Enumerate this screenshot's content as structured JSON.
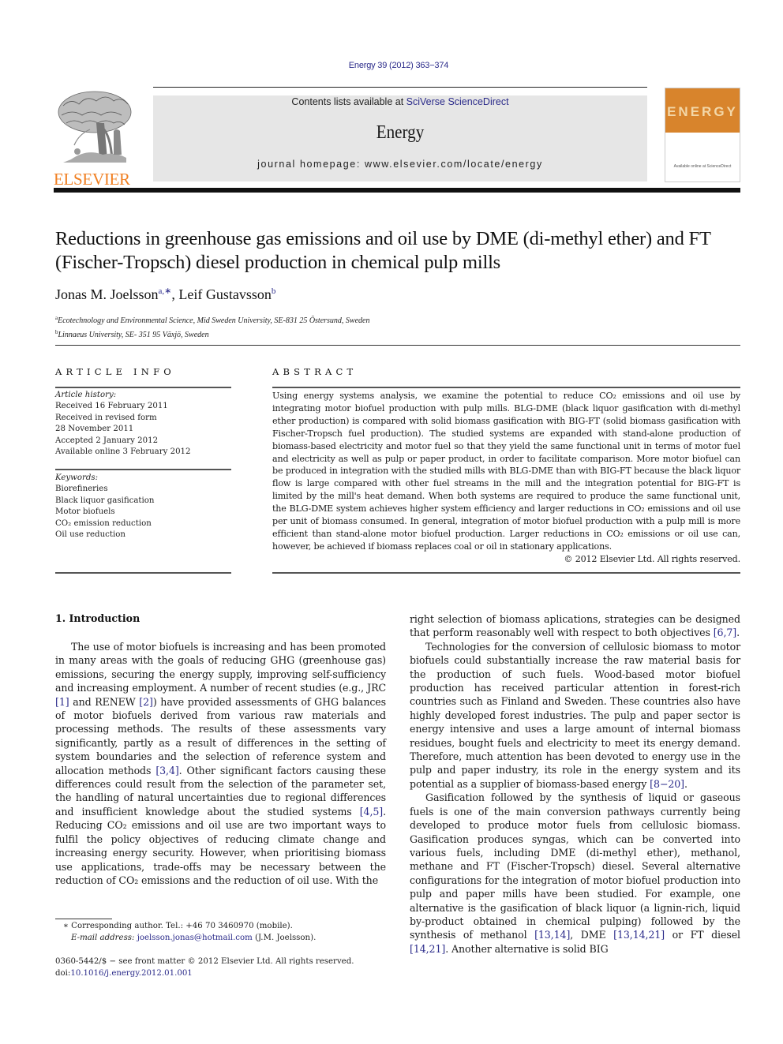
{
  "header": {
    "citation": "Energy 39 (2012) 363−374",
    "contents_prefix": "Contents lists available at ",
    "contents_link": "SciVerse ScienceDirect",
    "journal_name": "Energy",
    "homepage": "journal homepage: www.elsevier.com/locate/energy",
    "publisher_logo_text": "ELSEVIER",
    "cover_title": "ENERGY",
    "cover_footer": "Available online at ScienceDirect",
    "colors": {
      "publisher_orange": "#f07f21",
      "cover_orange": "#d8842c",
      "link_blue": "#2b2b8a",
      "banner_gray": "#e6e6e6"
    }
  },
  "article": {
    "title": "Reductions in greenhouse gas emissions and oil use by DME (di-methyl ether) and FT (Fischer-Tropsch) diesel production in chemical pulp mills",
    "authors": [
      {
        "name": "Jonas M. Joelsson",
        "marks": "a,∗"
      },
      {
        "name": "Leif Gustavsson",
        "marks": "b"
      }
    ],
    "author_separator": ", ",
    "affiliations": [
      {
        "mark": "a",
        "text": "Ecotechnology and Environmental Science, Mid Sweden University, SE-831 25 Östersund, Sweden"
      },
      {
        "mark": "b",
        "text": "Linnaeus University, SE- 351 95 Växjö, Sweden"
      }
    ]
  },
  "article_info": {
    "heading": "ARTICLE INFO",
    "history_label": "Article history:",
    "history": [
      "Received 16 February 2011",
      "Received in revised form",
      "28 November 2011",
      "Accepted 2 January 2012",
      "Available online 3 February 2012"
    ],
    "keywords_label": "Keywords:",
    "keywords": [
      "Biorefineries",
      "Black liquor gasification",
      "Motor biofuels",
      "CO₂ emission reduction",
      "Oil use reduction"
    ]
  },
  "abstract": {
    "heading": "ABSTRACT",
    "text": "Using energy systems analysis, we examine the potential to reduce CO₂ emissions and oil use by integrating motor biofuel production with pulp mills. BLG-DME (black liquor gasification with di-methyl ether production) is compared with solid biomass gasification with BIG-FT (solid biomass gasification with Fischer-Tropsch fuel production). The studied systems are expanded with stand-alone production of biomass-based electricity and motor fuel so that they yield the same functional unit in terms of motor fuel and electricity as well as pulp or paper product, in order to facilitate comparison. More motor biofuel can be produced in integration with the studied mills with BLG-DME than with BIG-FT because the black liquor flow is large compared with other fuel streams in the mill and the integration potential for BIG-FT is limited by the mill's heat demand. When both systems are required to produce the same functional unit, the BLG-DME system achieves higher system efficiency and larger reductions in CO₂ emissions and oil use per unit of biomass consumed. In general, integration of motor biofuel production with a pulp mill is more efficient than stand-alone motor biofuel production. Larger reductions in CO₂ emissions or oil use can, however, be achieved if biomass replaces coal or oil in stationary applications.",
    "copyright": "© 2012 Elsevier Ltd. All rights reserved."
  },
  "body": {
    "section_heading": "1.  Introduction",
    "left_paragraphs": [
      [
        {
          "t": "The use of motor biofuels is increasing and has been promoted in many areas with the goals of reducing GHG (greenhouse gas) emissions, securing the energy supply, improving self-sufficiency and increasing employment. A number of recent studies (e.g., JRC "
        },
        {
          "ref": "[1]"
        },
        {
          "t": " and RENEW "
        },
        {
          "ref": "[2]"
        },
        {
          "t": ") have provided assessments of GHG balances of motor biofuels derived from various raw materials and processing methods. The results of these assessments vary significantly, partly as a result of differences in the setting of system boundaries and the selection of reference system and allocation methods "
        },
        {
          "ref": "[3,4]"
        },
        {
          "t": ". Other significant factors causing these differences could result from the selection of the parameter set, the handling of natural uncertainties due to regional differences and insufficient knowledge about the studied systems "
        },
        {
          "ref": "[4,5]"
        },
        {
          "t": ". Reducing CO₂ emissions and oil use are two important ways to fulfil the policy objectives of reducing climate change and increasing energy security. However, when prioritising biomass use applications, trade-offs may be necessary between the reduction of CO₂ emissions and the reduction of oil use. With the"
        }
      ]
    ],
    "right_paragraphs": [
      [
        {
          "t": "right selection of biomass aplications, strategies can be designed that perform reasonably well with respect to both objectives "
        },
        {
          "ref": "[6,7]"
        },
        {
          "t": "."
        }
      ],
      [
        {
          "t": "Technologies for the conversion of cellulosic biomass to motor biofuels could substantially increase the raw material basis for the production of such fuels. Wood-based motor biofuel production has received particular attention in forest-rich countries such as Finland and Sweden. These countries also have highly developed forest industries. The pulp and paper sector is energy intensive and uses a large amount of internal biomass residues, bought fuels and electricity to meet its energy demand. Therefore, much attention has been devoted to energy use in the pulp and paper industry, its role in the energy system and its potential as a supplier of biomass-based energy "
        },
        {
          "ref": "[8−20]"
        },
        {
          "t": "."
        }
      ],
      [
        {
          "t": "Gasification followed by the synthesis of liquid or gaseous fuels is one of the main conversion pathways currently being developed to produce motor fuels from cellulosic biomass. Gasification produces syngas, which can be converted into various fuels, including DME (di-methyl ether), methanol, methane and FT (Fischer-Tropsch) diesel. Several alternative configurations for the integration of motor biofuel production into pulp and paper mills have been studied. For example, one alternative is the gasification of black liquor (a lignin-rich, liquid by-product obtained in chemical pulping) followed by the synthesis of methanol "
        },
        {
          "ref": "[13,14]"
        },
        {
          "t": ", DME "
        },
        {
          "ref": "[13,14,21]"
        },
        {
          "t": " or FT diesel "
        },
        {
          "ref": "[14,21]"
        },
        {
          "t": ". Another alternative is solid BIG"
        }
      ]
    ]
  },
  "footnotes": {
    "corresponding": "∗  Corresponding author. Tel.: +46 70 3460970 (mobile).",
    "email_label": "E-mail address: ",
    "email": "joelsson.jonas@hotmail.com",
    "email_suffix": " (J.M. Joelsson).",
    "issn_line": "0360-5442/$ − see front matter © 2012 Elsevier Ltd. All rights reserved.",
    "doi_label": "doi:",
    "doi": "10.1016/j.energy.2012.01.001"
  }
}
